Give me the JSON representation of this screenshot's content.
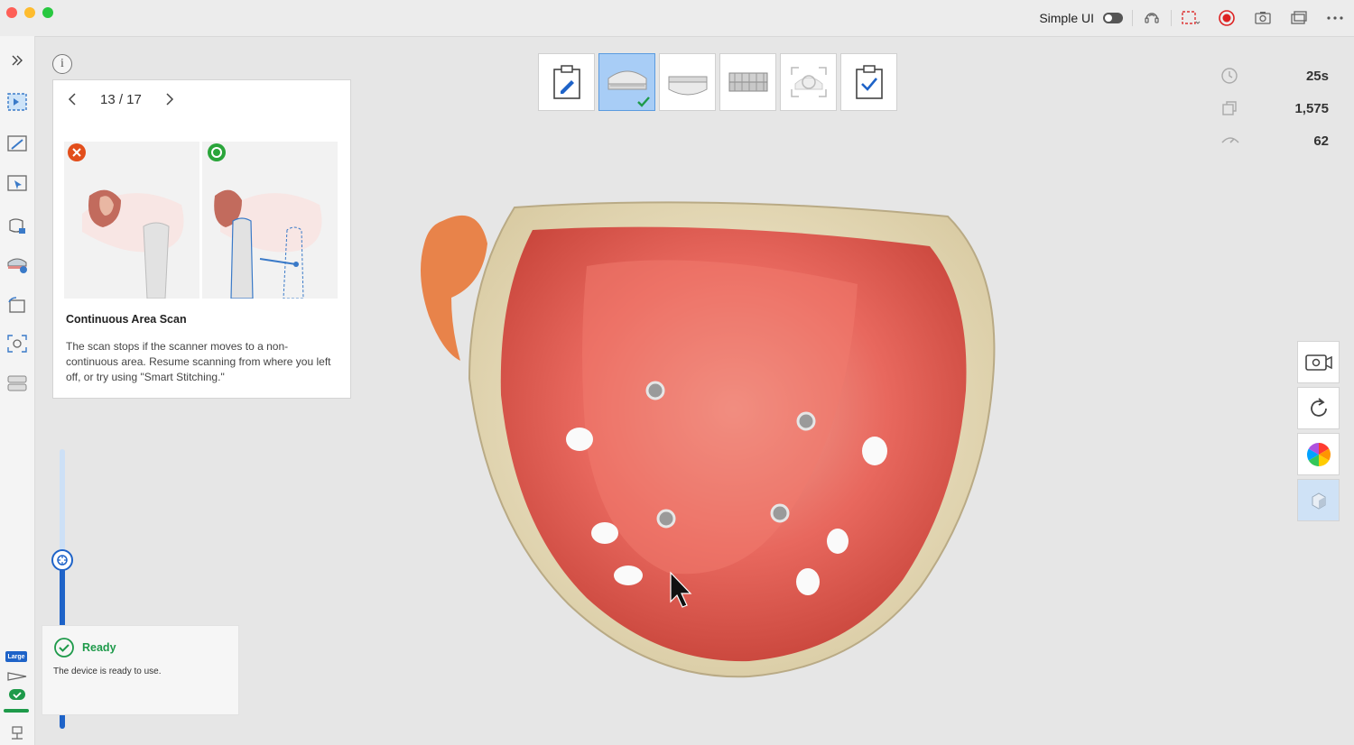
{
  "titlebar": {
    "simple_ui_label": "Simple UI",
    "icons": [
      "support-icon",
      "fullscreen-icon",
      "record-icon",
      "camera-icon",
      "window-icon",
      "more-icon"
    ]
  },
  "sidebar": {
    "items": [
      "scan-mode-icon",
      "edit-scan-icon",
      "select-region-icon",
      "lock-tooth-icon",
      "upper-jaw-icon",
      "rotate-view-icon",
      "snapshot-icon",
      "dentition-icon"
    ],
    "bottom": {
      "size_badge": "Large"
    }
  },
  "tip_card": {
    "page": "13 / 17",
    "title": "Continuous Area Scan",
    "body": "The scan stops if the scanner moves to a non-continuous area. Resume scanning from where you left off, or try using \"Smart Stitching.\""
  },
  "status": {
    "title": "Ready",
    "description": "The device is ready to use."
  },
  "steps": [
    {
      "name": "prescription",
      "active": false
    },
    {
      "name": "upper-jaw",
      "active": true
    },
    {
      "name": "lower-jaw",
      "active": false
    },
    {
      "name": "occlusion",
      "active": false
    },
    {
      "name": "inspection",
      "active": false
    },
    {
      "name": "review",
      "active": false
    }
  ],
  "stats": {
    "time": "25s",
    "images": "1,575",
    "speed": "62"
  },
  "colors": {
    "accent": "#1e63c8",
    "ready_green": "#1e9a4a",
    "active_step": "#a8cdf6",
    "tissue": "#e8685e"
  }
}
